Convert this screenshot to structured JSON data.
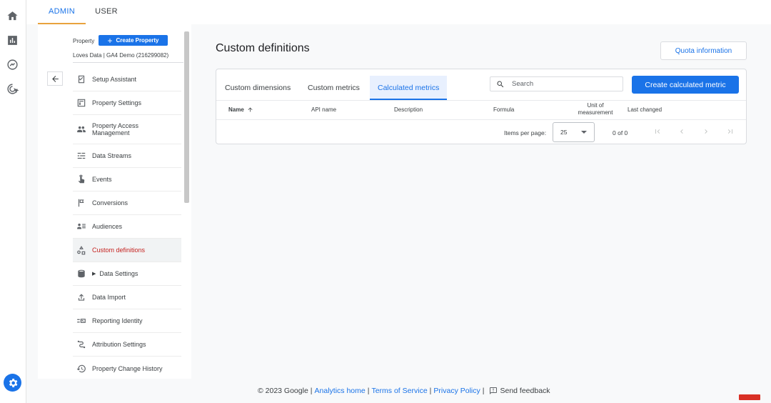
{
  "top_tabs": {
    "admin": "ADMIN",
    "user": "USER"
  },
  "nav": {
    "property_label": "Property",
    "create_property": "Create Property",
    "property_name": "Loves Data | GA4 Demo (216299082)",
    "items": [
      {
        "label": "Setup Assistant",
        "icon": "checklist-icon"
      },
      {
        "label": "Property Settings",
        "icon": "property-icon"
      },
      {
        "label": "Property Access Management",
        "icon": "people-icon"
      },
      {
        "label": "Data Streams",
        "icon": "streams-icon"
      },
      {
        "label": "Events",
        "icon": "touch-icon"
      },
      {
        "label": "Conversions",
        "icon": "flag-icon"
      },
      {
        "label": "Audiences",
        "icon": "audience-icon"
      },
      {
        "label": "Custom definitions",
        "icon": "shapes-icon",
        "active": true
      },
      {
        "label": "Data Settings",
        "icon": "database-icon"
      },
      {
        "label": "Data Import",
        "icon": "upload-icon"
      },
      {
        "label": "Reporting Identity",
        "icon": "identity-icon"
      },
      {
        "label": "Attribution Settings",
        "icon": "attribution-icon"
      },
      {
        "label": "Property Change History",
        "icon": "history-icon"
      }
    ]
  },
  "main": {
    "title": "Custom definitions",
    "quota_button": "Quota information",
    "tabs": [
      "Custom dimensions",
      "Custom metrics",
      "Calculated metrics"
    ],
    "active_tab": "Calculated metrics",
    "search_placeholder": "Search",
    "create_button": "Create calculated metric",
    "columns": {
      "name": "Name",
      "api": "API name",
      "description": "Description",
      "formula": "Formula",
      "unit": "Unit of measurement",
      "changed": "Last changed"
    },
    "pagination": {
      "items_per_page_label": "Items per page:",
      "items_per_page": "25",
      "range": "0 of 0"
    }
  },
  "footer": {
    "copyright": "© 2023 Google",
    "analytics_home": "Analytics home",
    "terms": "Terms of Service",
    "privacy": "Privacy Policy",
    "feedback": "Send feedback"
  },
  "colors": {
    "accent": "#1a73e8",
    "active_nav_text": "#c5221f",
    "admin_underline": "#e8a33d"
  }
}
